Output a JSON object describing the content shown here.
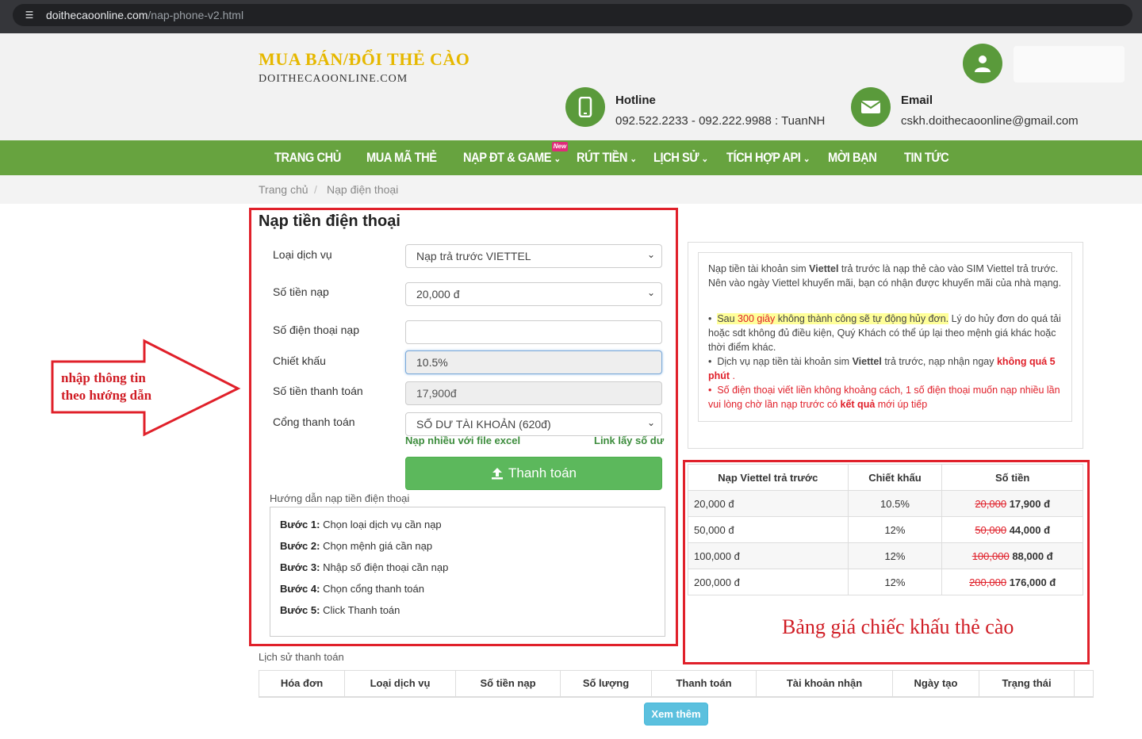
{
  "browser": {
    "url_domain": "doithecaoonline.com",
    "url_path": "/nap-phone-v2.html"
  },
  "header": {
    "logo_main": "MUA BÁN/ĐỔI THẺ CÀO",
    "logo_sub": "DOITHECAOONLINE.COM",
    "hotline_title": "Hotline",
    "hotline_value": "092.522.2233 - 092.222.9988 : TuanNH",
    "email_title": "Email",
    "email_value": "cskh.doithecaoonline@gmail.com"
  },
  "nav": {
    "items": [
      {
        "label": "TRANG CHỦ"
      },
      {
        "label": "MUA MÃ THẺ"
      },
      {
        "label": "NẠP ĐT & GAME"
      },
      {
        "label": "RÚT TIỀN"
      },
      {
        "label": "LỊCH SỬ"
      },
      {
        "label": "TÍCH HỢP API"
      },
      {
        "label": "MỜI BẠN"
      },
      {
        "label": "TIN TỨC"
      }
    ],
    "new_badge": "New"
  },
  "breadcrumb": {
    "home": "Trang chủ",
    "sep": "/",
    "current": "Nạp điện thoại"
  },
  "form": {
    "title": "Nạp tiền điện thoại",
    "service_label": "Loại dịch vụ",
    "service_value": "Nạp trả trước VIETTEL",
    "amount_label": "Số tiền nạp",
    "amount_value": "20,000 đ",
    "phone_label": "Số điện thoại nạp",
    "phone_value": "",
    "discount_label": "Chiết khấu",
    "discount_value": "10.5%",
    "pay_amount_label": "Số tiền thanh toán",
    "pay_amount_value": "17,900đ",
    "gateway_label": "Cổng thanh toán",
    "gateway_value": "SỐ DƯ TÀI KHOẢN (620đ)",
    "excel_link": "Nạp nhiều với file excel",
    "balance_link": "Link lấy số dư",
    "pay_button": "Thanh toán"
  },
  "guide": {
    "title": "Hướng dẫn nạp tiền điện thoại",
    "steps": [
      {
        "b": "Bước 1:",
        "t": " Chọn loại dịch vụ cần nạp"
      },
      {
        "b": "Bước 2:",
        "t": " Chọn mệnh giá cần nạp"
      },
      {
        "b": "Bước 3:",
        "t": " Nhập số điện thoại cần nạp"
      },
      {
        "b": "Bước 4:",
        "t": " Chọn cổng thanh toán"
      },
      {
        "b": "Bước 5:",
        "t": " Click Thanh toán"
      }
    ]
  },
  "annotation": {
    "arrow_line1": "nhập thông tin",
    "arrow_line2": "theo hướng dẫn",
    "price_note": "Bảng giá chiếc khấu thẻ cào"
  },
  "info": {
    "p1_a": "Nạp tiền tài khoản sim ",
    "p1_b": "Viettel",
    "p1_c": " trả trước là nạp thẻ cào vào SIM Viettel trả trước. Nên vào ngày Viettel khuyến mãi, bạn có nhận được khuyến mãi của nhà mạng.",
    "b1_a": "Sau ",
    "b1_b": "300 giây",
    "b1_c": " không thành công sẽ tự động hủy đơn.",
    "b1_d": " Lý do hủy đơn do quá tải hoặc sdt không đủ điều kiện, Quý Khách có thể úp lại theo mệnh giá khác hoặc thời điểm khác.",
    "b2_a": "Dịch vụ nạp tiền tài khoản sim ",
    "b2_b": "Viettel",
    "b2_c": " trả trước, nạp nhận ngay ",
    "b2_d": "không quá 5 phút",
    "b2_e": " .",
    "b3_a": "Số điện thoại viết liền không khoảng cách, 1 số điện thoại muốn nạp nhiều lần vui lòng chờ lần nạp trước có ",
    "b3_b": "kết quả",
    "b3_c": " mới úp tiếp"
  },
  "price_table": {
    "headers": [
      "Nạp Viettel trả trước",
      "Chiết khấu",
      "Số tiền"
    ],
    "rows": [
      {
        "name": "20,000 đ",
        "discount": "10.5%",
        "old": "20,000",
        "new": "17,900 đ"
      },
      {
        "name": "50,000 đ",
        "discount": "12%",
        "old": "50,000",
        "new": "44,000 đ"
      },
      {
        "name": "100,000 đ",
        "discount": "12%",
        "old": "100,000",
        "new": "88,000 đ"
      },
      {
        "name": "200,000 đ",
        "discount": "12%",
        "old": "200,000",
        "new": "176,000 đ"
      }
    ]
  },
  "history": {
    "title": "Lịch sử thanh toán",
    "headers": [
      "Hóa đơn",
      "Loại dịch vụ",
      "Số tiền nạp",
      "Số lượng",
      "Thanh toán",
      "Tài khoản nhận",
      "Ngày tạo",
      "Trạng thái"
    ],
    "more_button": "Xem thêm"
  },
  "colors": {
    "brand_green": "#67a33f",
    "annotation_red": "#e0202a",
    "button_green": "#5cb85c",
    "button_info": "#5bc0de"
  }
}
